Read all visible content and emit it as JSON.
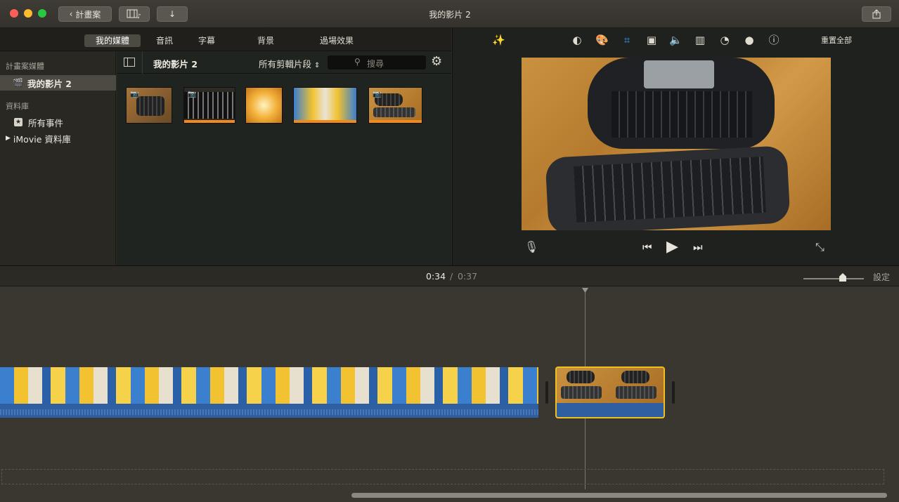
{
  "window": {
    "title": "我的影片 2"
  },
  "toolbar": {
    "back_label": "計畫案"
  },
  "tabs": [
    {
      "label": "我的媒體",
      "active": true
    },
    {
      "label": "音訊",
      "active": false
    },
    {
      "label": "字幕",
      "active": false
    },
    {
      "label": "背景",
      "active": false
    },
    {
      "label": "過場效果",
      "active": false
    }
  ],
  "sidebar": {
    "project_media_heading": "計畫案媒體",
    "project_item": "我的影片 2",
    "library_heading": "資料庫",
    "all_events": "所有事件",
    "imovie_library": "iMovie 資料庫"
  },
  "browser": {
    "title": "我的影片 2",
    "filter": "所有剪輯片段",
    "search_placeholder": "搜尋"
  },
  "viewer": {
    "reset_all": "重置全部"
  },
  "timeline": {
    "current_time": "0:34",
    "separator": "/",
    "total_time": "0:37",
    "settings": "設定"
  },
  "colors": {
    "accent": "#f2c230",
    "audio": "#2f5fa0",
    "selection": "#f0c020"
  }
}
